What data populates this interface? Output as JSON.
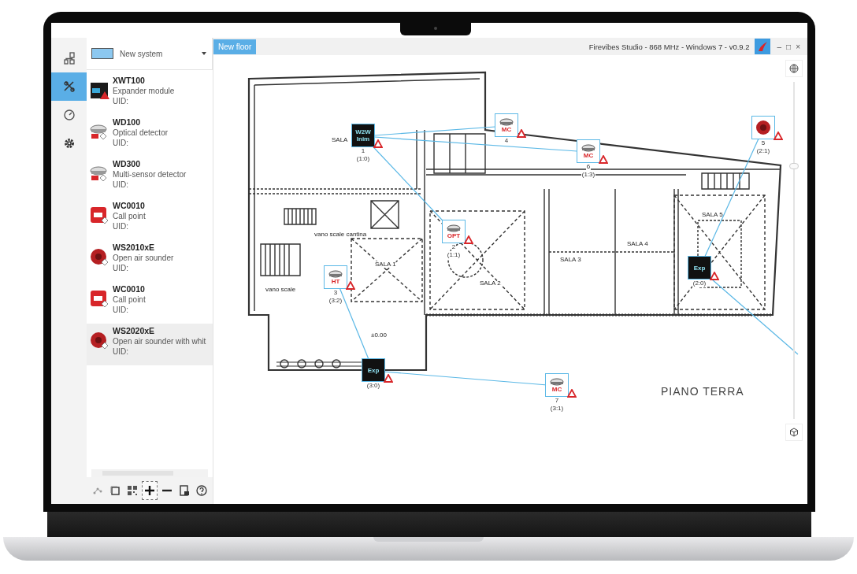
{
  "window": {
    "title": "Firevibes Studio - 868 MHz - Windows 7 - v0.9.2",
    "controls": [
      "–",
      "□",
      "×"
    ]
  },
  "rail": [
    {
      "kind": "network",
      "selected": false
    },
    {
      "kind": "tools",
      "selected": true
    },
    {
      "kind": "gauge",
      "selected": false
    },
    {
      "kind": "settings",
      "selected": false
    }
  ],
  "system": {
    "name": "New system",
    "color": "#8cc8f0"
  },
  "devices": [
    {
      "kind": "expander",
      "name": "XWT100",
      "description": "Expander module",
      "uid": "UID:",
      "selected": false
    },
    {
      "kind": "detector",
      "name": "WD100",
      "description": "Optical detector",
      "uid": "UID:",
      "selected": false
    },
    {
      "kind": "detector",
      "name": "WD300",
      "description": "Multi-sensor detector",
      "uid": "UID:",
      "selected": false
    },
    {
      "kind": "callpoint",
      "name": "WC0010",
      "description": "Call point",
      "uid": "UID:",
      "selected": false
    },
    {
      "kind": "sounder",
      "name": "WS2010xE",
      "description": "Open air sounder",
      "uid": "UID:",
      "selected": false
    },
    {
      "kind": "callpoint",
      "name": "WC0010",
      "description": "Call point",
      "uid": "UID:",
      "selected": false
    },
    {
      "kind": "sounder",
      "name": "WS2020xE",
      "description": "Open air sounder with whit",
      "uid": "UID:",
      "selected": true
    }
  ],
  "toolbar": [
    {
      "kind": "network",
      "pressed": false
    },
    {
      "kind": "copy",
      "pressed": false
    },
    {
      "kind": "qr",
      "pressed": false
    },
    {
      "kind": "plus",
      "pressed": true
    },
    {
      "kind": "minus",
      "pressed": false
    },
    {
      "kind": "export",
      "pressed": false
    },
    {
      "kind": "help",
      "pressed": false
    }
  ],
  "tabs": [
    {
      "label": "New floor",
      "selected": true
    }
  ],
  "rooms": [
    "SALA",
    "vano scale cantina",
    "SALA 1",
    "SALA 2",
    "SALA 3",
    "SALA 4",
    "SALA 5",
    "vano scale",
    "±0.00"
  ],
  "floor_name": "PIANO TERRA",
  "placed": [
    {
      "kind": "expander",
      "tag": "W2W Inim",
      "number": "1",
      "address": "(1:0)",
      "warning": true
    },
    {
      "kind": "detector",
      "tag": "MC",
      "number": "4",
      "warning": true
    },
    {
      "kind": "detector",
      "tag": "MC",
      "number": "6",
      "address": "(1:3)",
      "warning": true
    },
    {
      "kind": "sounder",
      "number": "5",
      "address": "(2:1)",
      "warning": true
    },
    {
      "kind": "detector",
      "tag": "OPT",
      "number": "2",
      "address": "(1:1)",
      "warning": true
    },
    {
      "kind": "detector",
      "tag": "HT",
      "number": "3",
      "address": "(3:2)",
      "warning": true
    },
    {
      "kind": "expander",
      "tag": "Exp",
      "address": "(3:0)",
      "warning": true
    },
    {
      "kind": "expander",
      "tag": "Exp",
      "address": "(2:0)",
      "warning": true
    },
    {
      "kind": "detector",
      "tag": "MC",
      "number": "7",
      "address": "(3:1)",
      "warning": true
    }
  ],
  "zoom_slider": {
    "level": 0.75
  }
}
